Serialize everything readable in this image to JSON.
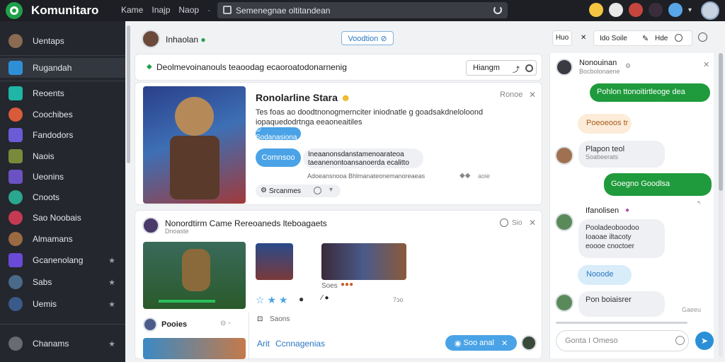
{
  "app": {
    "title": "Komunitaro"
  },
  "topnav": [
    "Kame",
    "Inajp",
    "Naop"
  ],
  "search": {
    "text": "Semenegnae oltitandean"
  },
  "sidebar": {
    "items": [
      {
        "label": "Uentaps"
      },
      {
        "label": "Rugandah"
      },
      {
        "label": "Reoents"
      },
      {
        "label": "Coochibes"
      },
      {
        "label": "Fandodors"
      },
      {
        "label": "Naois"
      },
      {
        "label": "Ueonins"
      },
      {
        "label": "Cnoots"
      },
      {
        "label": "Sao Noobais"
      },
      {
        "label": "Almamans"
      },
      {
        "label": "Gcanenolang"
      },
      {
        "label": "Sabs"
      },
      {
        "label": "Uemis"
      },
      {
        "label": "Chanams"
      }
    ],
    "star": "★"
  },
  "main": {
    "header": {
      "name": "Inhaolan",
      "button": "Voodtion ⊘"
    },
    "compose": {
      "text": "Deolmevoinanouls teaoodag ecaoroatodonarnenig",
      "button": "Hiangm",
      "icon": "⤴"
    },
    "post1": {
      "title": "Ronolarline Stara",
      "meta": "Ronoe",
      "body_line1": "Tes foas ao doodtnonogmernciter iniodnatle g goadsakdneloloond",
      "body_line2": "iopaquedodrtnga eeaoneaitiles",
      "tag": "© Sodanasiona",
      "button": "Comnsoo",
      "reply_line1": "Ineaanonsdanstamenoarateoa",
      "reply_line2": "taeanenontoansanoerda ecalitto",
      "reply_meta": "Adoeansnooa Bhlmanateonemanoreaeas",
      "reply_suffix": "aoie",
      "footer": "Srcanmes"
    },
    "post2": {
      "title": "Nonordtirm Came Rereoaneds lteboagaets",
      "subtitle": "Dnoaste",
      "meta": "Sio",
      "likes": "Soes",
      "count": "7ɔo",
      "user": "Pooies",
      "comment_label": "Saons",
      "link1": "Arit",
      "link2": "Ccnnagenias",
      "pill": "Soo anal"
    }
  },
  "right": {
    "toolbar": [
      "Huo",
      "Ido Soile",
      "Hde"
    ],
    "chat": {
      "head_name": "Nonouinan",
      "head_sub": "Bocbolonaene",
      "msg1": "Pohlon ttonoitirtleoge dea",
      "msg2": "Poeoeoos tr",
      "msg3_name": "Plapon teol",
      "msg3_sub": "Soabeerats",
      "msg4": "Goegno Goodlsa",
      "msg5_name": "Ifanolisen",
      "msg5_lines": [
        "Pooladeoboodoo",
        "Ioaoae iltacoty",
        "eoooe cnoctoer"
      ],
      "msg6": "Nooode",
      "msg7_name": "Pon boiaisrer",
      "msg7_time": "Gaeeu",
      "input": "Gonta I Omeso"
    }
  }
}
